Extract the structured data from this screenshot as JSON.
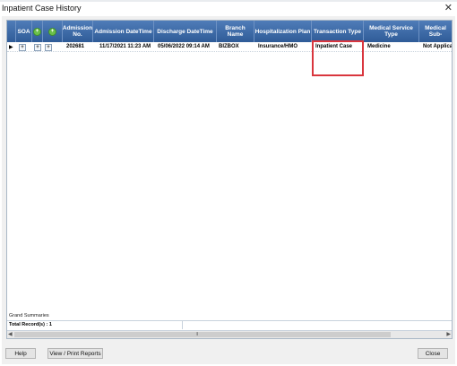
{
  "window": {
    "title": "Inpatient Case History",
    "close_glyph": "✕"
  },
  "columns": {
    "soa": "SOA",
    "admission_no": "Admission No.",
    "admission_datetime": "Admission DateTime",
    "discharge_datetime": "Discharge DateTime",
    "branch_name": "Branch Name",
    "hospitalization_plan": "Hospitalization Plan",
    "transaction_type": "Transaction Type",
    "medical_service_type": "Medical Service Type",
    "medical_sub": "Medical Sub-"
  },
  "rows": [
    {
      "admission_no": "202681",
      "admission_datetime": "11/17/2021 11:23 AM",
      "discharge_datetime": "05/06/2022 09:14 AM",
      "branch_name": "BIZBOX",
      "hospitalization_plan": "Insurance/HMO",
      "transaction_type": "Inpatient Case",
      "medical_service_type": "Medicine",
      "medical_sub": "Not Applicab"
    }
  ],
  "summary": {
    "label": "Grand Summaries",
    "total": "Total Record(s) : 1"
  },
  "buttons": {
    "help": "Help",
    "view_print": "View / Print Reports",
    "close": "Close"
  },
  "colors": {
    "header": "#3a67a6",
    "highlight": "#d9363e",
    "plus_icon": "#6cc04a"
  }
}
